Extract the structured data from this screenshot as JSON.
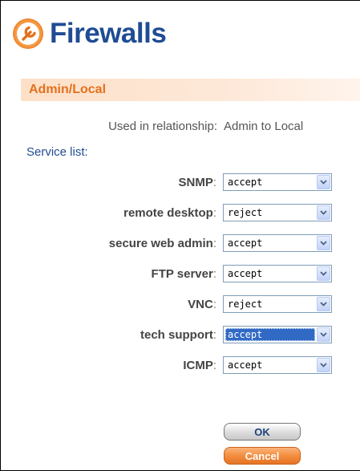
{
  "app": {
    "title": "Firewalls",
    "icon": "wrench-icon",
    "accent": "#e2711d",
    "title_color": "#1f4c94"
  },
  "section": {
    "title": "Admin/Local"
  },
  "relationship": {
    "label": "Used in relationship:",
    "value": "Admin to Local"
  },
  "service_list": {
    "heading": "Service list:",
    "services": [
      {
        "label": "SNMP",
        "value": "accept"
      },
      {
        "label": "remote desktop",
        "value": "reject"
      },
      {
        "label": "secure web admin",
        "value": "accept"
      },
      {
        "label": "FTP server",
        "value": "accept"
      },
      {
        "label": "VNC",
        "value": "reject"
      },
      {
        "label": "tech support",
        "value": "accept",
        "selected": true
      },
      {
        "label": "ICMP",
        "value": "accept"
      }
    ]
  },
  "buttons": {
    "ok": "OK",
    "cancel": "Cancel"
  }
}
